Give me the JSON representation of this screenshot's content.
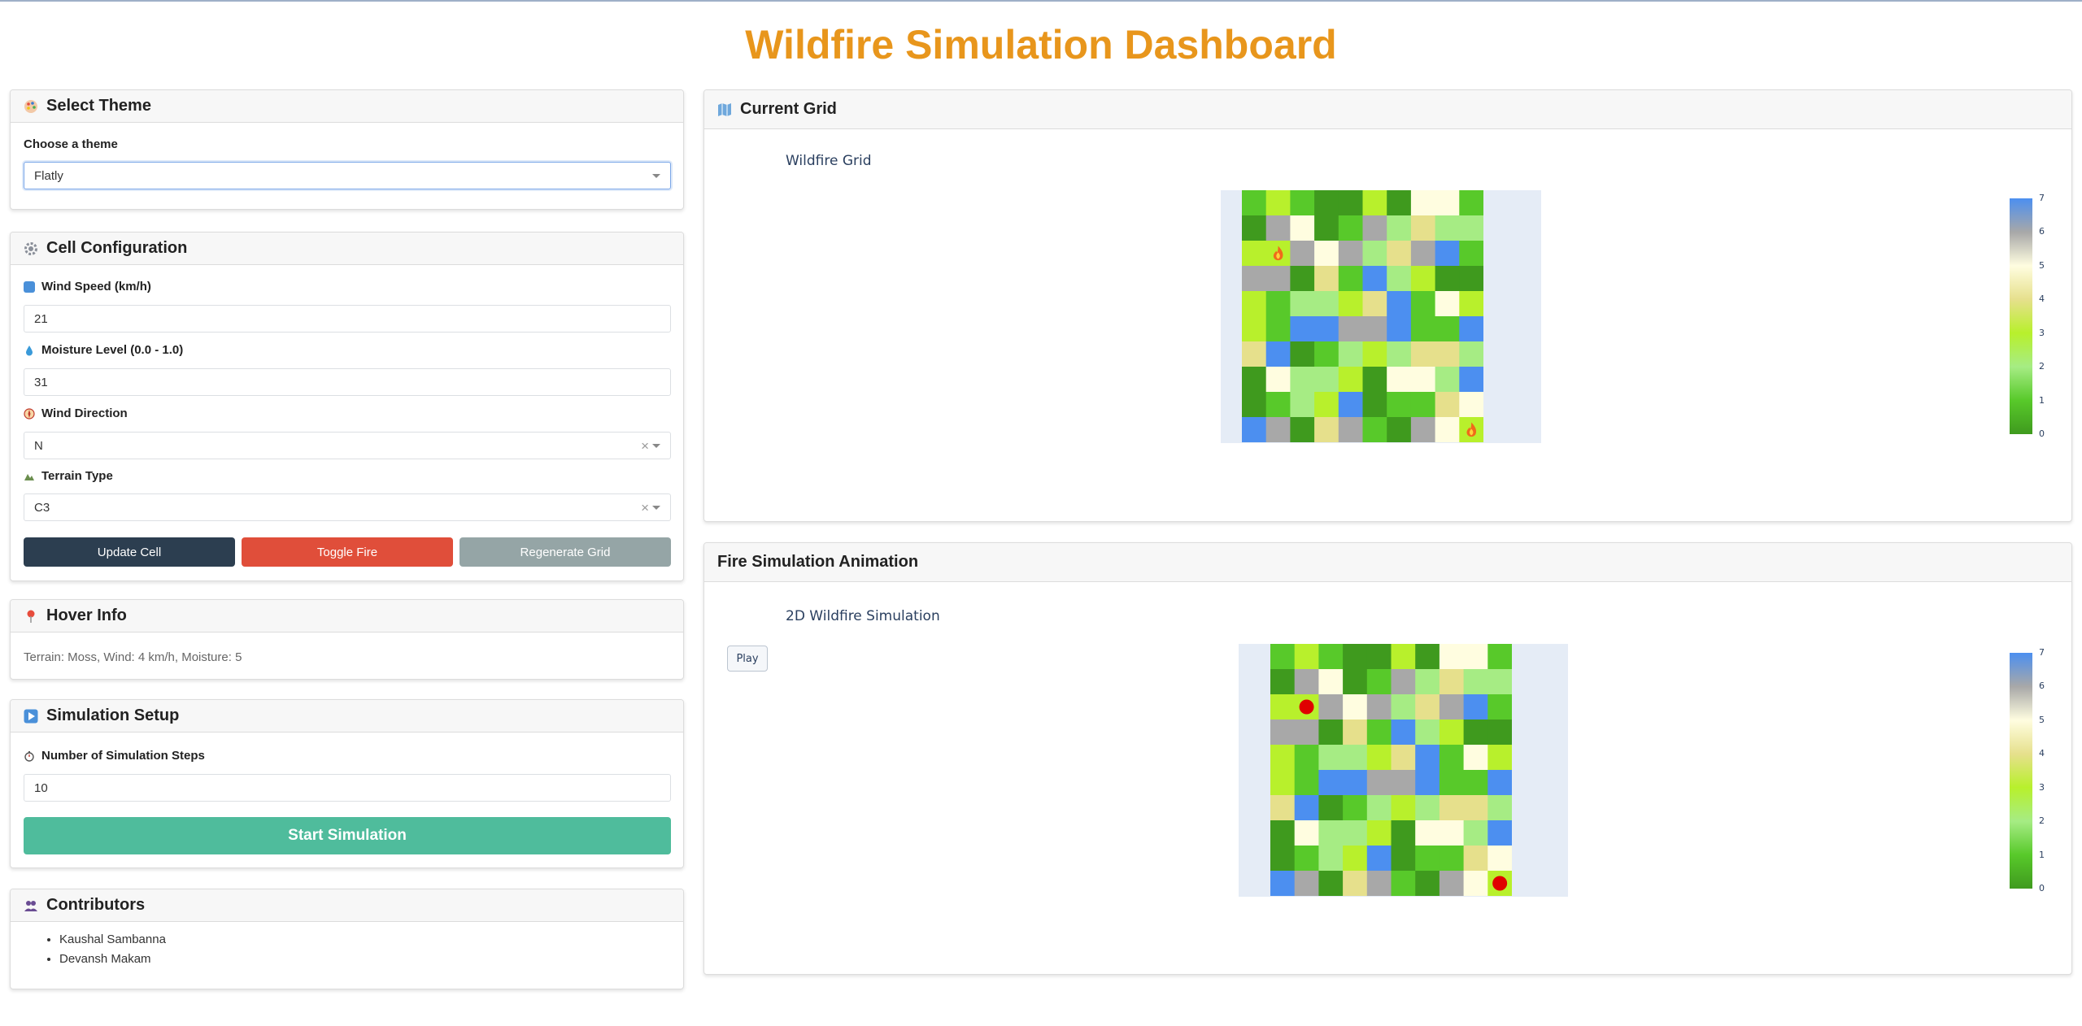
{
  "header": {
    "title": "Wildfire Simulation Dashboard"
  },
  "theme_card": {
    "title": "Select Theme",
    "label": "Choose a theme",
    "selected": "Flatly"
  },
  "cell_config": {
    "title": "Cell Configuration",
    "wind_speed_label": "Wind Speed (km/h)",
    "wind_speed_value": "21",
    "moisture_label": "Moisture Level (0.0 - 1.0)",
    "moisture_value": "31",
    "wind_direction_label": "Wind Direction",
    "wind_direction_value": "N",
    "terrain_label": "Terrain Type",
    "terrain_value": "C3",
    "update_button": "Update Cell",
    "toggle_button": "Toggle Fire",
    "regenerate_button": "Regenerate Grid"
  },
  "hover_info": {
    "title": "Hover Info",
    "text": "Terrain: Moss, Wind: 4 km/h, Moisture: 5"
  },
  "simulation_setup": {
    "title": "Simulation Setup",
    "steps_label": "Number of Simulation Steps",
    "steps_value": "10",
    "start_button": "Start Simulation"
  },
  "contributors": {
    "title": "Contributors",
    "names": [
      "Kaushal Sambanna",
      "Devansh Makam"
    ]
  },
  "current_grid": {
    "title": "Current Grid",
    "plot_title": "Wildfire Grid"
  },
  "animation": {
    "title": "Fire Simulation Animation",
    "plot_title": "2D Wildfire Simulation",
    "play_label": "Play"
  },
  "colors": {
    "accent_title": "#e8961c",
    "update": "#2c3e50",
    "toggle": "#e74c3c",
    "regenerate": "#95a5a6",
    "start": "#4fbc9c",
    "fire_marker": "#e00000"
  },
  "chart_data": {
    "type": "heatmap",
    "rows": 10,
    "cols": 10,
    "colorbar_ticks": [
      "0",
      "1",
      "2",
      "3",
      "4",
      "5",
      "6",
      "7"
    ],
    "colorscale": [
      "#3f9a1e",
      "#58c92a",
      "#a6ec84",
      "#b8f02c",
      "#e6e08c",
      "#fffde0",
      "#a8a8a8",
      "#4c8ff0"
    ],
    "values": [
      [
        1,
        3,
        1,
        0,
        0,
        3,
        0,
        5,
        5,
        1
      ],
      [
        0,
        6,
        5,
        0,
        1,
        6,
        2,
        4,
        2,
        2
      ],
      [
        3,
        3,
        6,
        5,
        6,
        2,
        4,
        6,
        7,
        1
      ],
      [
        6,
        6,
        0,
        4,
        1,
        7,
        2,
        3,
        0,
        0
      ],
      [
        3,
        1,
        2,
        2,
        3,
        4,
        7,
        1,
        5,
        3
      ],
      [
        3,
        1,
        7,
        7,
        6,
        6,
        7,
        1,
        1,
        7
      ],
      [
        4,
        7,
        0,
        1,
        2,
        3,
        2,
        4,
        4,
        2
      ],
      [
        0,
        5,
        2,
        2,
        3,
        0,
        5,
        5,
        2,
        7
      ],
      [
        0,
        1,
        2,
        3,
        7,
        0,
        1,
        1,
        4,
        5
      ],
      [
        7,
        6,
        0,
        4,
        6,
        1,
        0,
        6,
        5,
        3
      ]
    ],
    "fire_cells": [
      [
        2,
        1
      ],
      [
        9,
        9
      ]
    ],
    "fire_icon": "fire-icon"
  }
}
